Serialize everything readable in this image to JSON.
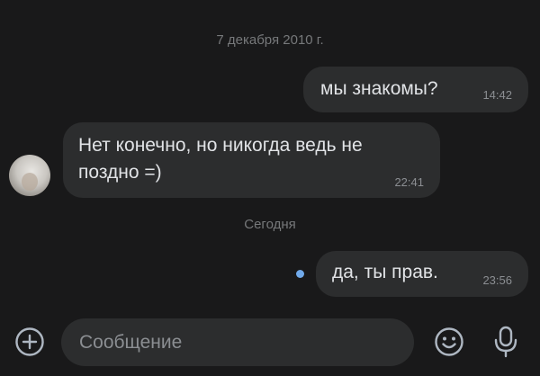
{
  "chat": {
    "date_separators": [
      "7 декабря 2010 г.",
      "Сегодня"
    ],
    "messages": [
      {
        "direction": "outgoing",
        "text": "мы знакомы?",
        "time": "14:42"
      },
      {
        "direction": "incoming",
        "text": "Нет конечно, но никогда ведь не поздно =)",
        "time": "22:41"
      },
      {
        "direction": "outgoing",
        "text": "да, ты прав.",
        "time": "23:56",
        "unread": true
      }
    ]
  },
  "composer": {
    "placeholder": "Сообщение",
    "value": ""
  },
  "icons": {
    "attach": "plus-circle-icon",
    "emoji": "smile-icon",
    "voice": "microphone-icon"
  },
  "colors": {
    "background": "#19191a",
    "bubble": "#2c2d2e",
    "text": "#e1e3e6",
    "secondary_text": "#76787a",
    "unread_dot": "#71aaeb",
    "icon": "#aeb7c2"
  }
}
